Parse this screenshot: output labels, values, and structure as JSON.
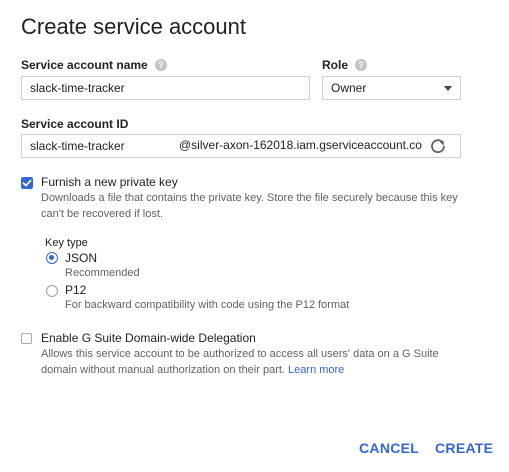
{
  "dialog": {
    "title": "Create service account"
  },
  "service_account_name": {
    "label": "Service account name",
    "value": "slack-time-tracker"
  },
  "role": {
    "label": "Role",
    "selected": "Owner"
  },
  "service_account_id": {
    "label": "Service account ID",
    "value": "slack-time-tracker",
    "domain_suffix": "@silver-axon-162018.iam.gserviceaccount.co"
  },
  "private_key": {
    "checked": true,
    "label": "Furnish a new private key",
    "description_line1": "Downloads a file that contains the private key. Store the file securely because this key",
    "description_line2": "can't be recovered if lost.",
    "key_type_label": "Key type",
    "options": [
      {
        "label": "JSON",
        "description": "Recommended",
        "selected": true
      },
      {
        "label": "P12",
        "description": "For backward compatibility with code using the P12 format",
        "selected": false
      }
    ]
  },
  "delegation": {
    "checked": false,
    "label": "Enable G Suite Domain-wide Delegation",
    "description_line1": "Allows this service account to be authorized to access all users' data on a G Suite",
    "description_line2": "domain without manual authorization on their part.",
    "learn_more": "Learn more"
  },
  "actions": {
    "cancel_label": "CANCEL",
    "create_label": "CREATE"
  },
  "colors": {
    "accent": "#3367d6",
    "border": "#cfcfcf",
    "secondary_text": "#616161"
  },
  "icons": {
    "help": "help-icon",
    "dropdown": "chevron-down-icon",
    "refresh": "refresh-icon",
    "checkbox": "checkbox-icon"
  }
}
